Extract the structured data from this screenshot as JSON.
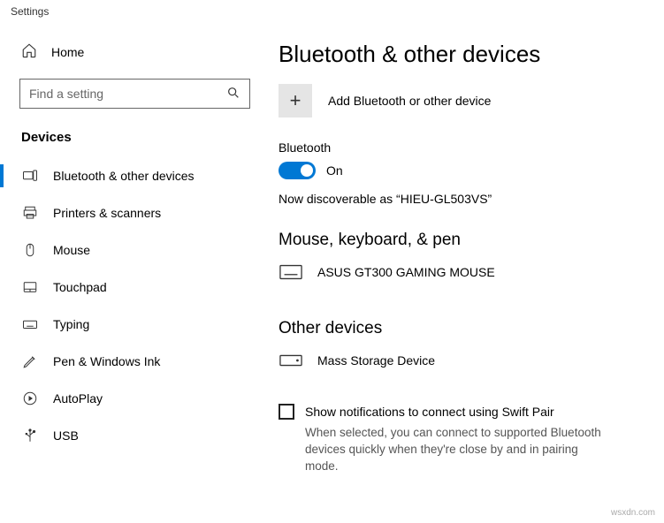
{
  "window_title": "Settings",
  "sidebar": {
    "home_label": "Home",
    "search_placeholder": "Find a setting",
    "section_label": "Devices",
    "items": [
      {
        "label": "Bluetooth & other devices",
        "active": true
      },
      {
        "label": "Printers & scanners"
      },
      {
        "label": "Mouse"
      },
      {
        "label": "Touchpad"
      },
      {
        "label": "Typing"
      },
      {
        "label": "Pen & Windows Ink"
      },
      {
        "label": "AutoPlay"
      },
      {
        "label": "USB"
      }
    ]
  },
  "main": {
    "page_title": "Bluetooth & other devices",
    "add_device_label": "Add Bluetooth or other device",
    "bluetooth_label": "Bluetooth",
    "bluetooth_state": "On",
    "discoverable_text": "Now discoverable as “HIEU-GL503VS”",
    "group1_title": "Mouse, keyboard, & pen",
    "group1_device": "ASUS GT300 GAMING MOUSE",
    "group2_title": "Other devices",
    "group2_device": "Mass Storage Device",
    "swift_pair_checkbox": "Show notifications to connect using Swift Pair",
    "swift_pair_hint": "When selected, you can connect to supported Bluetooth devices quickly when they're close by and in pairing mode."
  },
  "watermark": "wsxdn.com"
}
